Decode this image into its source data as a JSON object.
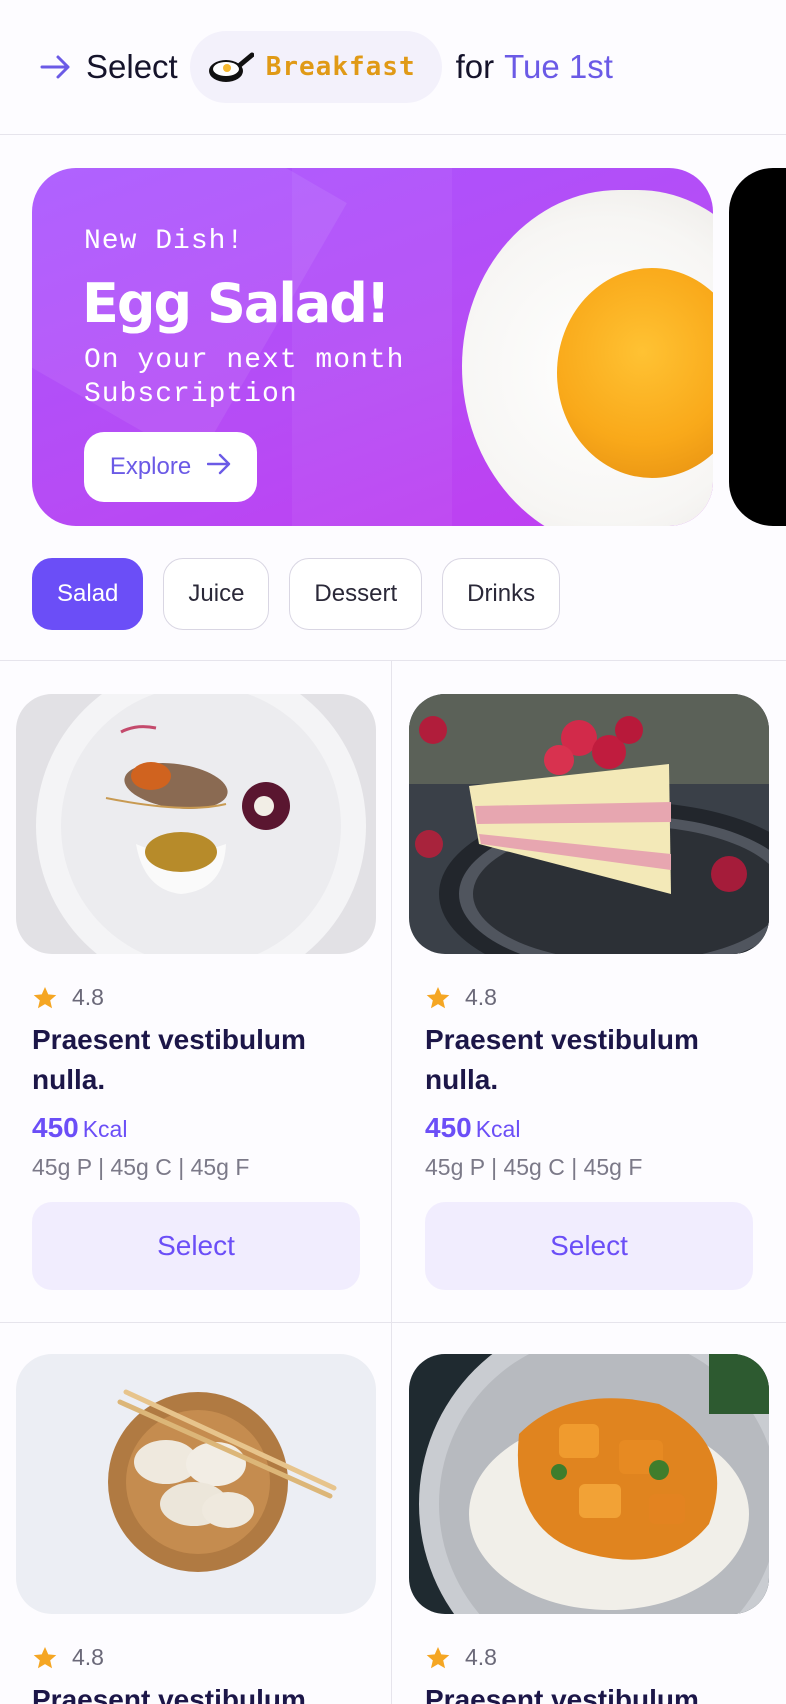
{
  "header": {
    "select_label": "Select",
    "meal": "Breakfast",
    "for_label": "for",
    "date": "Tue 1st"
  },
  "banner": {
    "kicker": "New Dish!",
    "title": "Egg Salad!",
    "subtitle": "On your next month Subscription",
    "button": "Explore"
  },
  "categories": [
    {
      "label": "Salad",
      "active": true
    },
    {
      "label": "Juice",
      "active": false
    },
    {
      "label": "Dessert",
      "active": false
    },
    {
      "label": "Drinks",
      "active": false
    }
  ],
  "dishes": [
    {
      "rating": "4.8",
      "name": "Praesent vestibulum nulla.",
      "kcal": "450",
      "kcal_unit": "Kcal",
      "macros": "45g P | 45g C | 45g F",
      "button": "Select",
      "image": "plated-fish-dish"
    },
    {
      "rating": "4.8",
      "name": "Praesent vestibulum nulla.",
      "kcal": "450",
      "kcal_unit": "Kcal",
      "macros": "45g P | 45g C | 45g F",
      "button": "Select",
      "image": "raspberry-cake-slice"
    },
    {
      "rating": "4.8",
      "name": "Praesent vestibulum",
      "image": "dumplings-bowl"
    },
    {
      "rating": "4.8",
      "name": "Praesent vestibulum",
      "image": "curry-with-rice"
    }
  ],
  "colors": {
    "accent": "#6b4ef7",
    "meal_label": "#e09a16",
    "banner": "#b64cf5",
    "star": "#f5a623"
  }
}
